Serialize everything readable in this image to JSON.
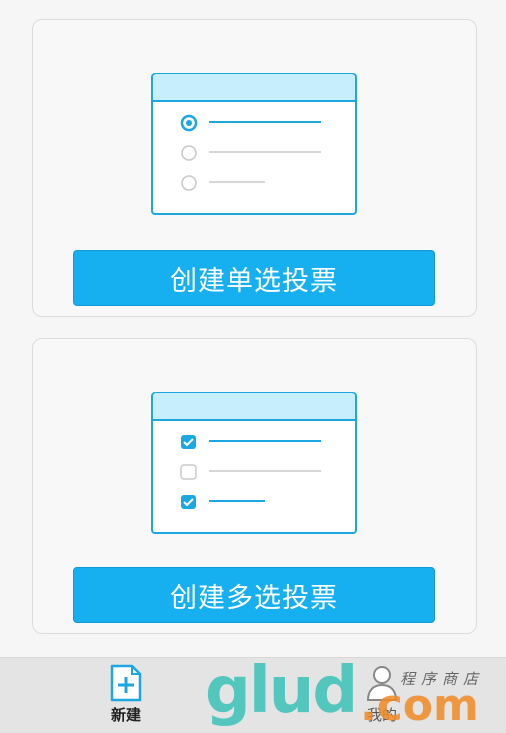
{
  "cards": [
    {
      "button_label": "创建单选投票"
    },
    {
      "button_label": "创建多选投票"
    }
  ],
  "tabbar": {
    "new_label": "新建",
    "mine_label": "我的"
  },
  "watermark": {
    "brand": "glud",
    "suffix": ".com",
    "subtitle": "程序商店"
  },
  "colors": {
    "accent": "#16b0f0",
    "illus_header": "#c7eefc",
    "illus_border": "#1ba7df",
    "inactive": "#c8c8c8"
  }
}
